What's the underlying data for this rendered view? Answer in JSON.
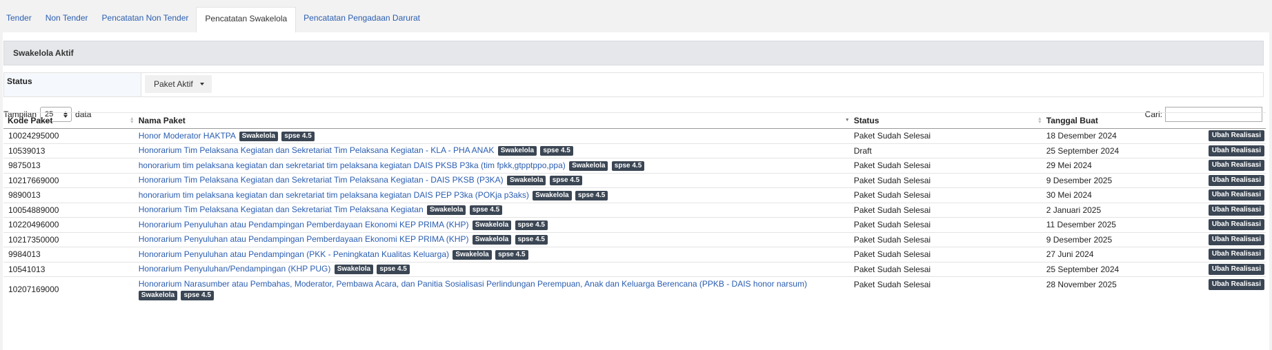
{
  "tabs": [
    "Tender",
    "Non Tender",
    "Pencatatan Non Tender",
    "Pencatatan Swakelola",
    "Pencatatan Pengadaan Darurat"
  ],
  "section_title": "Swakelola Aktif",
  "filter": {
    "label": "Status",
    "value": "Paket Aktif"
  },
  "length": {
    "prefix": "Tampilan",
    "value": "25",
    "suffix": "data"
  },
  "search": {
    "label": "Cari:",
    "value": ""
  },
  "columns": [
    "Kode Paket",
    "Nama Paket",
    "Status",
    "Tanggal Buat"
  ],
  "badges": {
    "type": "Swakelola",
    "version": "spse 4.5"
  },
  "action_label": "Ubah Realisasi",
  "rows": [
    {
      "kode": "10024295000",
      "nama": "Honor Moderator HAKTPA",
      "status": "Paket Sudah Selesai",
      "tanggal": "18 Desember 2024"
    },
    {
      "kode": "10539013",
      "nama": "Honorarium Tim Pelaksana Kegiatan dan Sekretariat Tim Pelaksana Kegiatan - KLA - PHA ANAK",
      "status": "Draft",
      "tanggal": "25 September 2024"
    },
    {
      "kode": "9875013",
      "nama": "honorarium tim pelaksana kegiatan dan sekretariat tim pelaksana kegiatan DAIS PKSB P3ka (tim fpkk,gtpptppo,ppa)",
      "status": "Paket Sudah Selesai",
      "tanggal": "29 Mei 2024"
    },
    {
      "kode": "10217669000",
      "nama": "Honorarium Tim Pelaksana Kegiatan dan Sekretariat Tim Pelaksana Kegiatan - DAIS PKSB (P3KA)",
      "status": "Paket Sudah Selesai",
      "tanggal": "9 Desember 2025"
    },
    {
      "kode": "9890013",
      "nama": "honorarium tim pelaksana kegiatan dan sekretariat tim pelaksana kegiatan DAIS PEP P3ka (POKja p3aks)",
      "status": "Paket Sudah Selesai",
      "tanggal": "30 Mei 2024"
    },
    {
      "kode": "10054889000",
      "nama": "Honorarium Tim Pelaksana Kegiatan dan Sekretariat Tim Pelaksana Kegiatan",
      "status": "Paket Sudah Selesai",
      "tanggal": "2 Januari 2025"
    },
    {
      "kode": "10220496000",
      "nama": "Honorarium Penyuluhan atau Pendampingan Pemberdayaan Ekonomi KEP PRIMA (KHP)",
      "status": "Paket Sudah Selesai",
      "tanggal": "11 Desember 2025"
    },
    {
      "kode": "10217350000",
      "nama": "Honorarium Penyuluhan atau Pendampingan Pemberdayaan Ekonomi KEP PRIMA (KHP)",
      "status": "Paket Sudah Selesai",
      "tanggal": "9 Desember 2025"
    },
    {
      "kode": "9984013",
      "nama": "Honorarium Penyuluhan atau Pendampingan (PKK - Peningkatan Kualitas Keluarga)",
      "status": "Paket Sudah Selesai",
      "tanggal": "27 Juni 2024"
    },
    {
      "kode": "10541013",
      "nama": "Honorarium Penyuluhan/Pendampingan (KHP PUG)",
      "status": "Paket Sudah Selesai",
      "tanggal": "25 September 2024"
    },
    {
      "kode": "10207169000",
      "nama": "Honorarium Narasumber atau Pembahas, Moderator, Pembawa Acara, dan Panitia Sosialisasi Perlindungan Perempuan, Anak dan Keluarga Berencana (PPKB - DAIS honor narsum)",
      "status": "Paket Sudah Selesai",
      "tanggal": "28 November 2025"
    }
  ]
}
